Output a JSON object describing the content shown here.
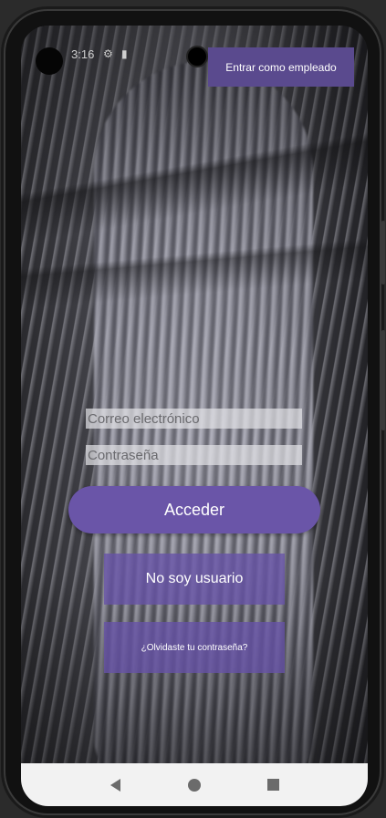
{
  "status_bar": {
    "time": "3:16",
    "icons": [
      "settings-icon",
      "sim-icon",
      "wifi-icon",
      "signal-icon",
      "battery-icon"
    ]
  },
  "header": {
    "employee_button_label": "Entrar como empleado"
  },
  "login_form": {
    "email_placeholder": "Correo electrónico",
    "email_value": "",
    "password_placeholder": "Contraseña",
    "password_value": "",
    "submit_label": "Acceder"
  },
  "secondary_actions": {
    "not_user_label": "No soy usuario",
    "forgot_password_label": "¿Olvidaste tu contraseña?"
  },
  "navigation_bar": {
    "back_icon": "back-triangle-icon",
    "home_icon": "home-circle-icon",
    "recents_icon": "recents-square-icon"
  },
  "colors": {
    "primary": "#6a55a8",
    "employee_button": "#5a4a8e",
    "nav_background": "#f2f2f2"
  }
}
